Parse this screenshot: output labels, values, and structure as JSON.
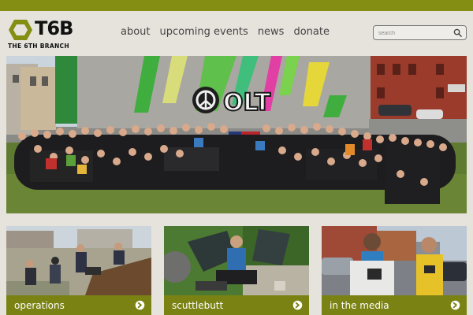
{
  "brand": {
    "name": "T6B",
    "tagline": "THE 6TH BRANCH",
    "logo_icon": "hexagon-logo-icon",
    "accent_color": "#848e12"
  },
  "nav": {
    "items": [
      "about",
      "upcoming events",
      "news",
      "donate"
    ]
  },
  "search": {
    "placeholder": "search",
    "icon": "search-icon"
  },
  "hero": {
    "mural_text": "OLT"
  },
  "cards": [
    {
      "label": "operations",
      "icon": "arrow-right-circle-icon"
    },
    {
      "label": "scuttlebutt",
      "icon": "arrow-right-circle-icon"
    },
    {
      "label": "in the media",
      "icon": "arrow-right-circle-icon"
    }
  ]
}
